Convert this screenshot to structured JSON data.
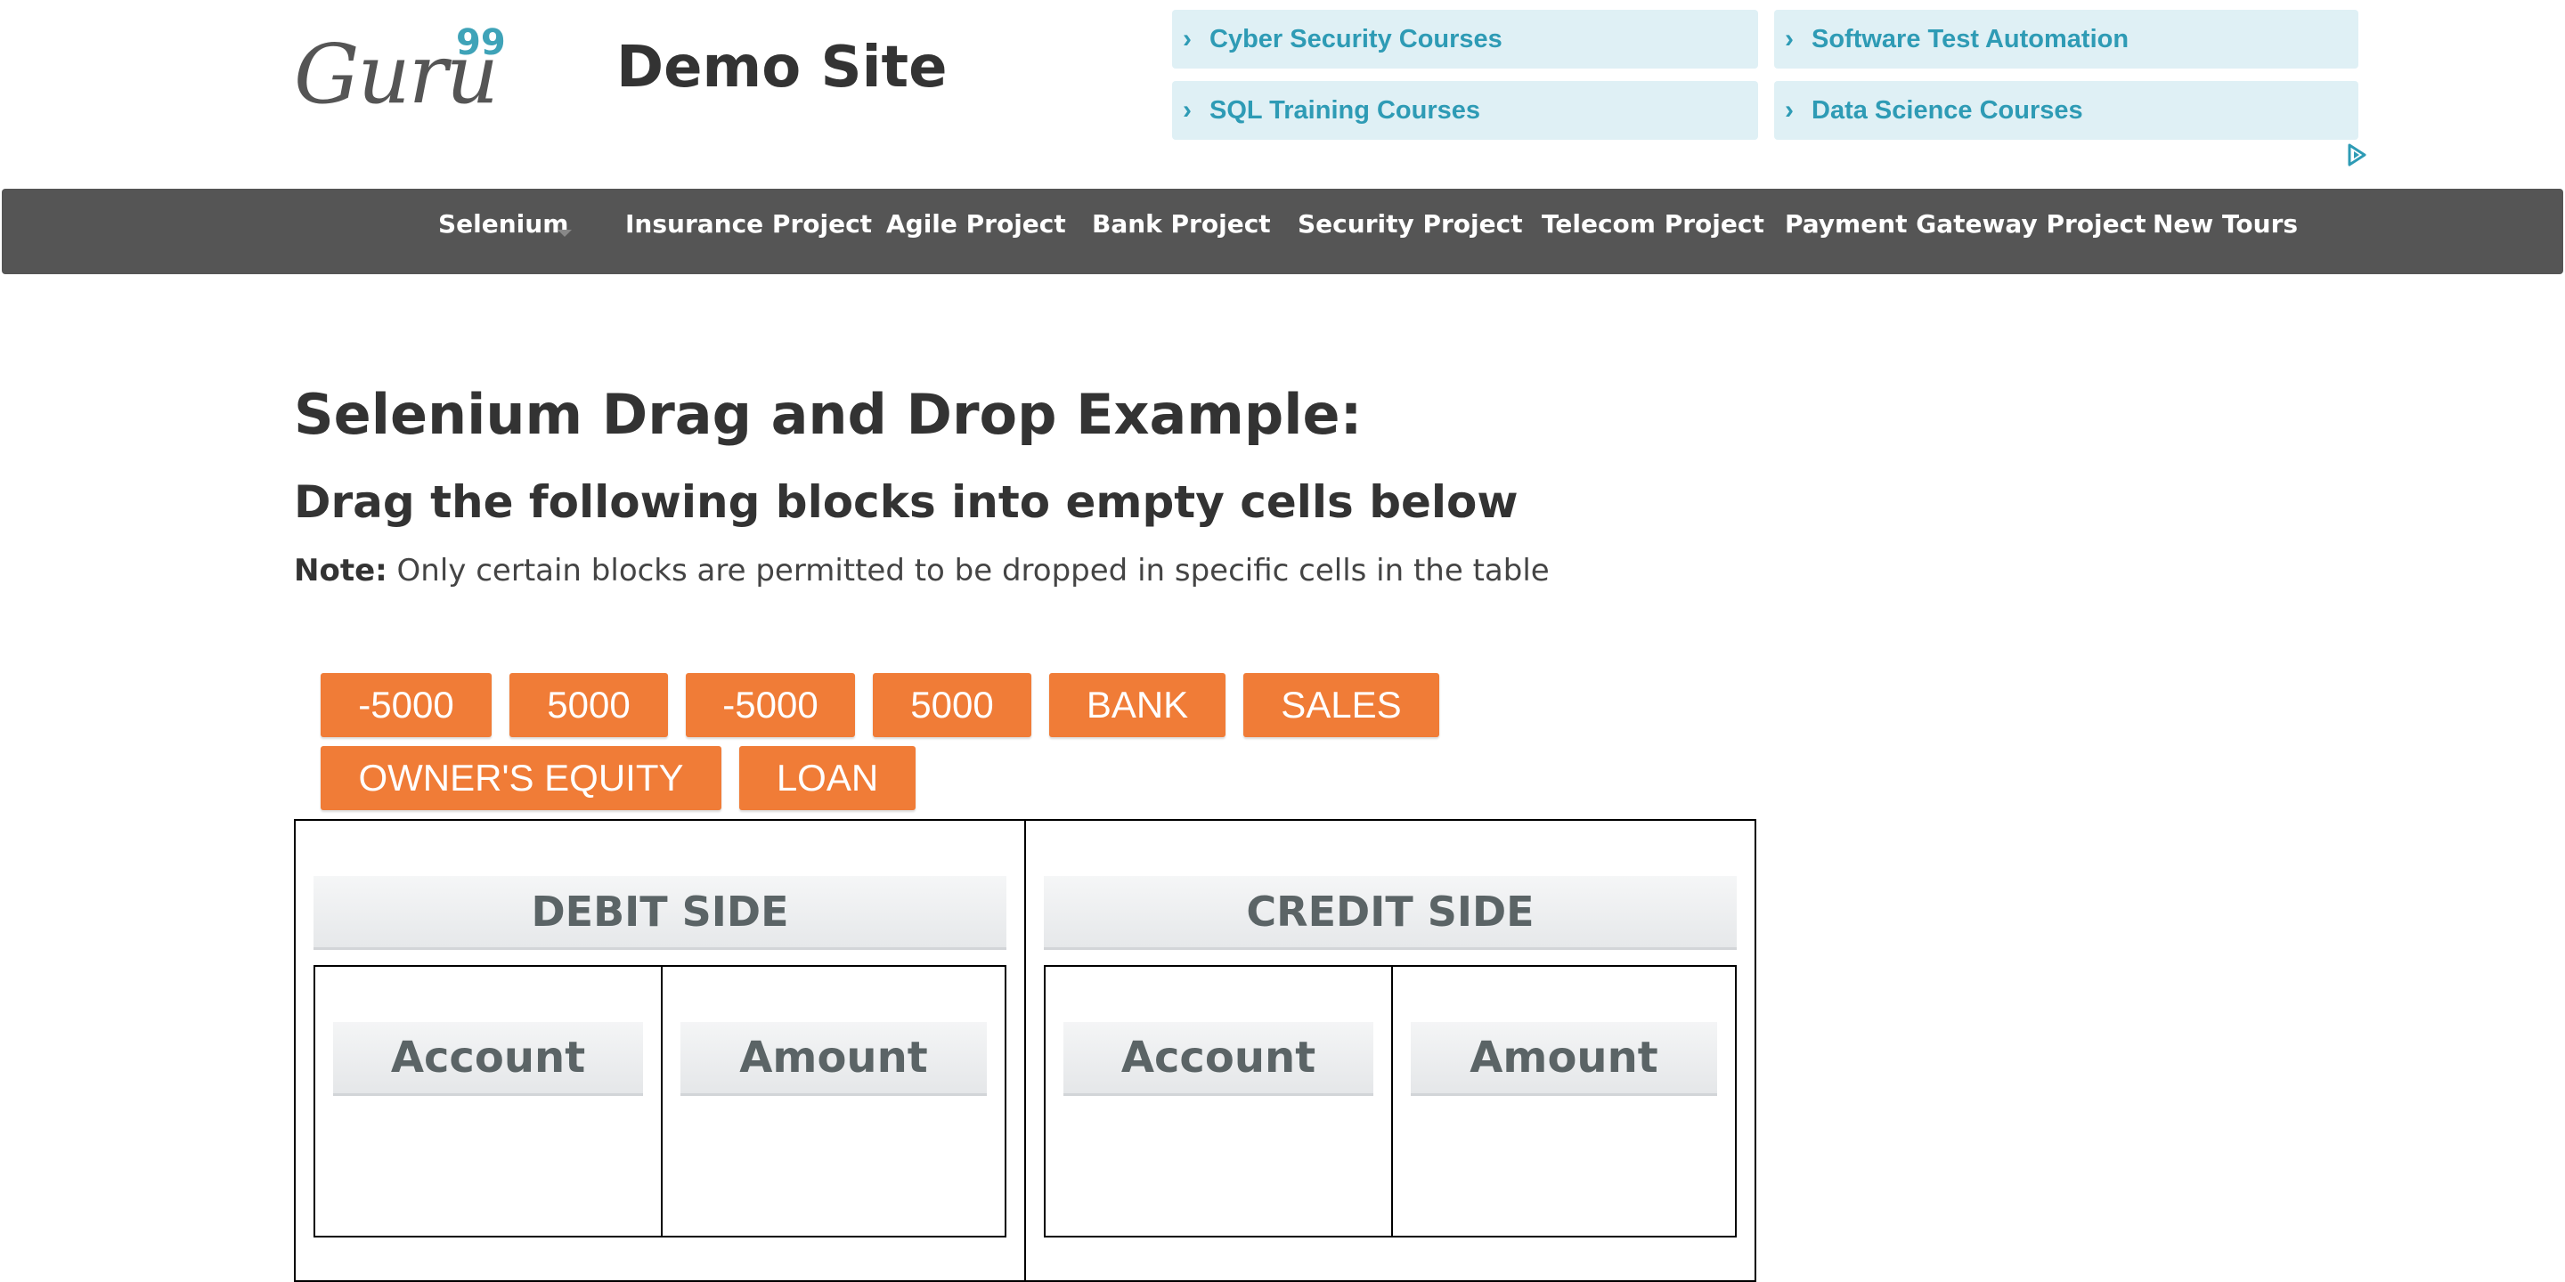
{
  "header": {
    "logo_text": "Guru",
    "logo_sup": "99",
    "site_title": "Demo Site"
  },
  "ads": [
    {
      "label": "Cyber Security Courses"
    },
    {
      "label": "Software Test Automation"
    },
    {
      "label": "SQL Training Courses"
    },
    {
      "label": "Data Science Courses"
    }
  ],
  "nav": {
    "items": [
      {
        "label": "Selenium"
      },
      {
        "label": "Insurance Project"
      },
      {
        "label": "Agile Project"
      },
      {
        "label": "Bank Project"
      },
      {
        "label": "Security Project"
      },
      {
        "label": "Telecom Project"
      },
      {
        "label": "Payment Gateway Project"
      },
      {
        "label": "New Tours"
      }
    ]
  },
  "content": {
    "heading": "Selenium Drag and Drop Example:",
    "subheading": "Drag the following blocks into empty cells below",
    "note_label": "Note:",
    "note_text": " Only certain blocks are permitted to be dropped in specific cells in the table"
  },
  "blocks": [
    {
      "label": "-5000"
    },
    {
      "label": "5000"
    },
    {
      "label": "-5000"
    },
    {
      "label": "5000"
    },
    {
      "label": "BANK"
    },
    {
      "label": "SALES"
    },
    {
      "label": "OWNER'S EQUITY"
    },
    {
      "label": "LOAN"
    }
  ],
  "table": {
    "debit": {
      "title": "DEBIT SIDE",
      "col_account": "Account",
      "col_amount": "Amount"
    },
    "credit": {
      "title": "CREDIT SIDE",
      "col_account": "Account",
      "col_amount": "Amount"
    }
  },
  "colors": {
    "accent": "#2e9bb5",
    "block": "#f07c37",
    "nav_bg": "#555555",
    "ad_bg": "#dff0f5"
  },
  "icons": {
    "ad_choices": "ad-choices-icon",
    "ad_chevron": "chevron-right-icon",
    "dropdown": "caret-down-icon"
  }
}
